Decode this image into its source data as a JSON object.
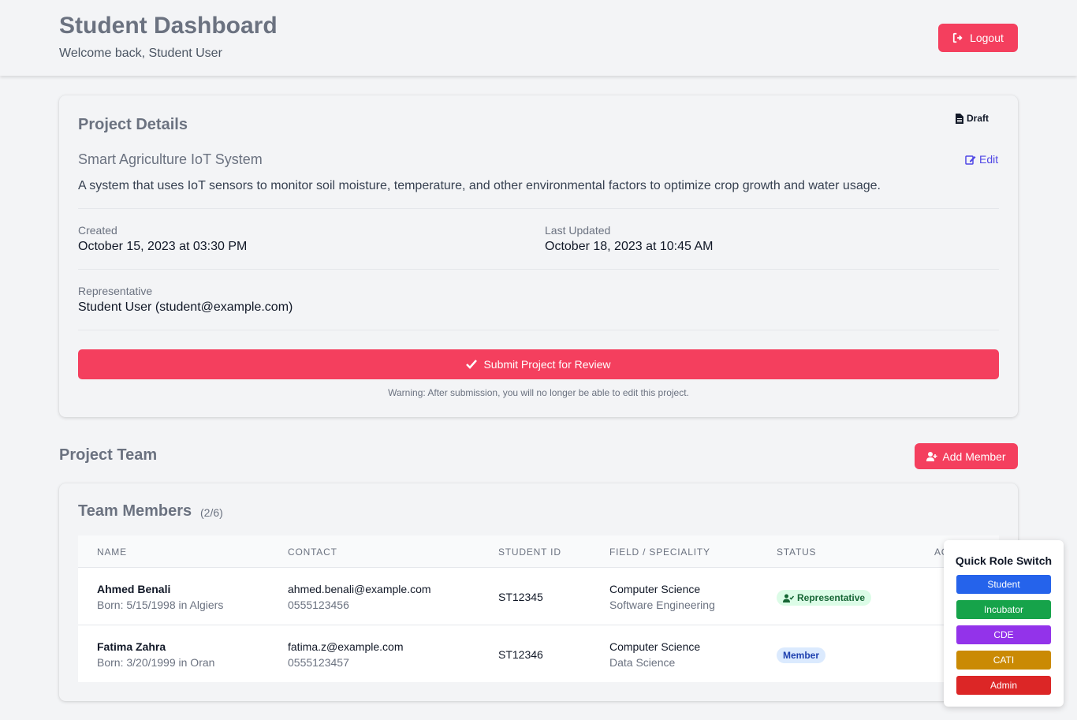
{
  "header": {
    "title": "Student Dashboard",
    "welcome": "Welcome back, Student User",
    "logout_label": "Logout"
  },
  "project": {
    "section_title": "Project Details",
    "status_label": "Draft",
    "name": "Smart Agriculture IoT System",
    "edit_label": "Edit",
    "description": "A system that uses IoT sensors to monitor soil moisture, temperature, and other environmental factors to optimize crop growth and water usage.",
    "created_label": "Created",
    "created_value": "October 15, 2023 at 03:30 PM",
    "updated_label": "Last Updated",
    "updated_value": "October 18, 2023 at 10:45 AM",
    "rep_label": "Representative",
    "rep_value": "Student User (student@example.com)",
    "submit_label": "Submit Project for Review",
    "warning": "Warning: After submission, you will no longer be able to edit this project."
  },
  "team": {
    "section_title": "Project Team",
    "add_member_label": "Add Member",
    "card_title": "Team Members",
    "count": "(2/6)",
    "columns": [
      "NAME",
      "CONTACT",
      "STUDENT ID",
      "FIELD / SPECIALITY",
      "STATUS",
      "ACTIONS"
    ],
    "rows": [
      {
        "name": "Ahmed Benali",
        "born": "Born: 5/15/1998 in Algiers",
        "email": "ahmed.benali@example.com",
        "phone": "0555123456",
        "student_id": "ST12345",
        "field": "Computer Science",
        "speciality": "Software Engineering",
        "status": "Representative"
      },
      {
        "name": "Fatima Zahra",
        "born": "Born: 3/20/1999 in Oran",
        "email": "fatima.z@example.com",
        "phone": "0555123457",
        "student_id": "ST12346",
        "field": "Computer Science",
        "speciality": "Data Science",
        "status": "Member"
      }
    ]
  },
  "role_switch": {
    "title": "Quick Role Switch",
    "roles": [
      {
        "label": "Student",
        "color": "#2563eb"
      },
      {
        "label": "Incubator",
        "color": "#16a34a"
      },
      {
        "label": "CDE",
        "color": "#9333ea"
      },
      {
        "label": "CATI",
        "color": "#ca8a04"
      },
      {
        "label": "Admin",
        "color": "#dc2626"
      }
    ]
  },
  "colors": {
    "accent": "#f43f5e",
    "edit_link": "#4f46e5"
  }
}
